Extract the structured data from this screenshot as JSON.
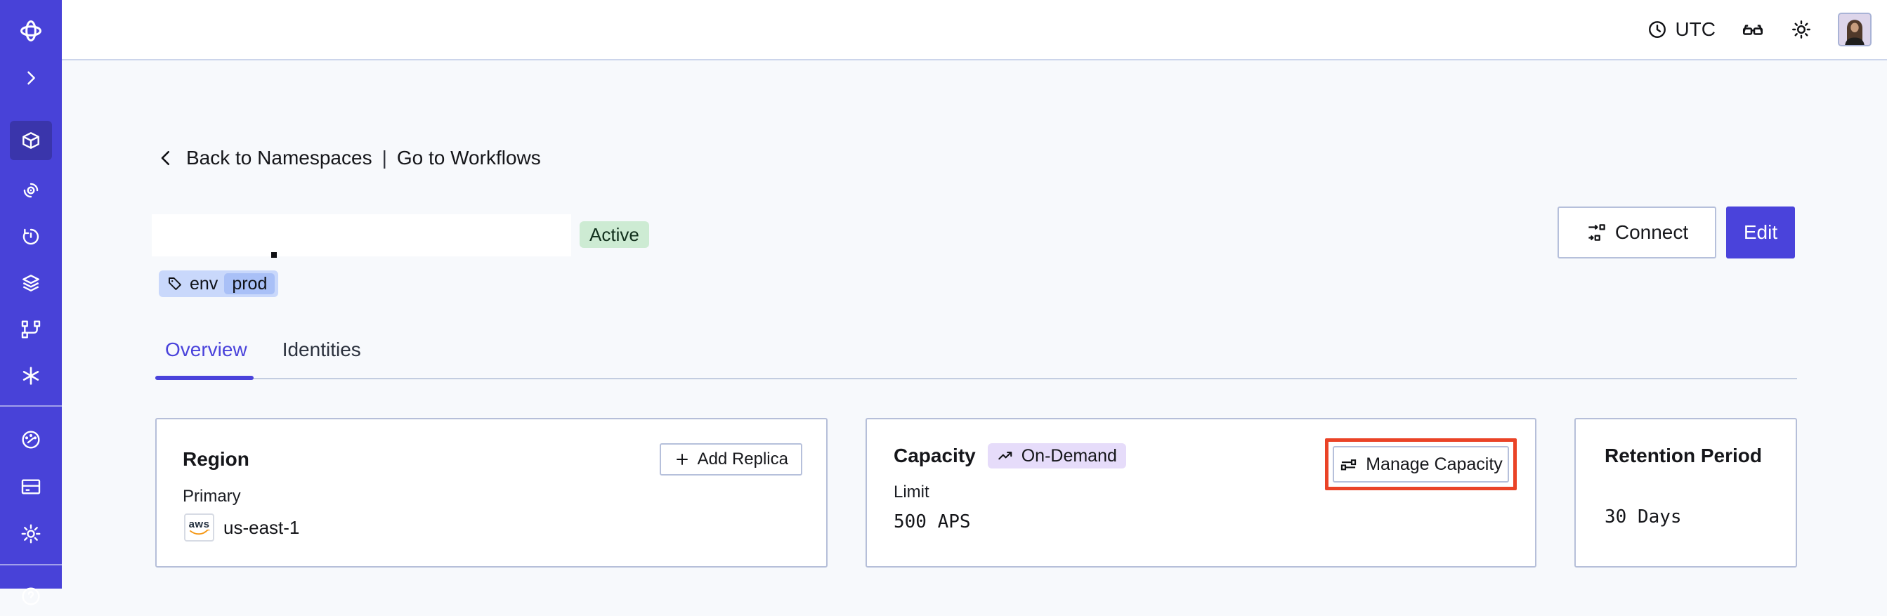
{
  "topbar": {
    "timezone": "UTC",
    "icons": [
      "clock-icon",
      "glasses-icon",
      "sun-icon",
      "avatar"
    ]
  },
  "sidebar": {
    "color": "#4842d8",
    "active_item": "namespaces",
    "items": [
      "temporal-logo",
      "expand-chevron",
      "namespaces",
      "archival",
      "schedules",
      "batch-operations",
      "deployments",
      "nexus",
      "usage",
      "billing",
      "settings",
      "help"
    ]
  },
  "breadcrumb": {
    "back": "Back to Namespaces",
    "separator": "|",
    "workflows": "Go to Workflows"
  },
  "header": {
    "namespace_name": "",
    "status": "Active",
    "tag": {
      "key": "env",
      "value": "prod"
    },
    "connect_label": "Connect",
    "edit_label": "Edit"
  },
  "tabs": [
    {
      "label": "Overview",
      "active": true
    },
    {
      "label": "Identities",
      "active": false
    }
  ],
  "cards": {
    "region": {
      "title": "Region",
      "add_replica_label": "Add Replica",
      "primary_label": "Primary",
      "provider": "aws",
      "value": "us-east-1"
    },
    "capacity": {
      "title": "Capacity",
      "mode_badge": "On-Demand",
      "manage_label": "Manage Capacity",
      "limit_label": "Limit",
      "limit_value": "500 APS"
    },
    "retention": {
      "title": "Retention Period",
      "value": "30 Days"
    }
  },
  "annotation": {
    "target": "manage-capacity-button",
    "highlight_color": "#ea4327"
  },
  "colors": {
    "sidebar": "#4842d8",
    "sidebar_active": "#3a35ab",
    "accent": "#4a43db",
    "page_bg": "#f7f9fc",
    "card_border": "#b6bfd9",
    "status_badge_bg": "#cdebd3",
    "tag_bg": "#c9d8fb",
    "tag_inner_bg": "#a9c0f7",
    "mode_badge_bg": "#e6dcfa",
    "aws_orange": "#f59815"
  }
}
